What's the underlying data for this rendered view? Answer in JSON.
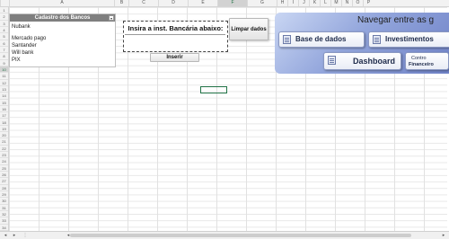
{
  "columns": [
    "A",
    "B",
    "C",
    "D",
    "E",
    "F",
    "G",
    "H",
    "I",
    "J",
    "K",
    "L",
    "M",
    "N",
    "O",
    "P"
  ],
  "rows": [
    "1",
    "2",
    "3",
    "4",
    "5",
    "6",
    "7",
    "8",
    "9",
    "10",
    "11",
    "12",
    "13",
    "14",
    "15",
    "16",
    "17",
    "18",
    "19",
    "20",
    "21",
    "22",
    "23",
    "24",
    "25",
    "26",
    "27",
    "28",
    "29",
    "30",
    "31",
    "32",
    "33",
    "34"
  ],
  "selected_column": "F",
  "selected_row": "10",
  "bank_table": {
    "header": "Cadastro dos Bancos",
    "items": [
      "Nubank",
      "Mercado pago",
      "Santander",
      "Will bank",
      "PIX"
    ]
  },
  "input_panel": {
    "label": "Insira a inst. Bancária abaixo:",
    "value": "",
    "insert_button": "Inserir",
    "clear_button": "Limpar dados"
  },
  "nav": {
    "title": "Navegar entre as g",
    "buttons": [
      "Base de dados",
      "Investimentos",
      "Dashboard"
    ],
    "controle_line1": "Contro",
    "controle_line2": "Financeiro"
  },
  "colors": {
    "accent": "#217346",
    "table_header": "#7f7f7f",
    "nav_gradient_start": "#c9d6f3",
    "nav_gradient_end": "#7083c8"
  }
}
